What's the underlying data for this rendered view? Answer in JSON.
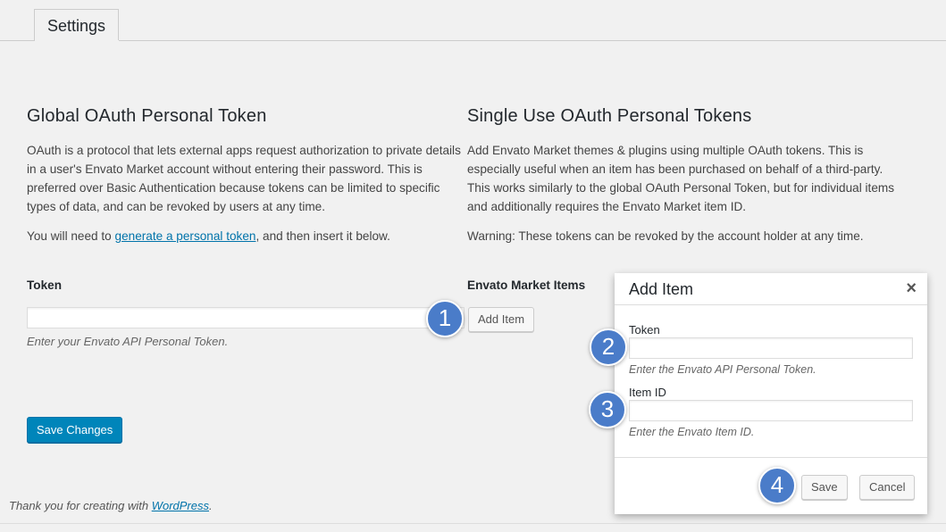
{
  "tabs": [
    {
      "label": "Settings"
    }
  ],
  "global": {
    "title": "Global OAuth Personal Token",
    "description": "OAuth is a protocol that lets external apps request authorization to private details in a user's Envato Market account without entering their password. This is preferred over Basic Authentication because tokens can be limited to specific types of data, and can be revoked by users at any time.",
    "instruction_prefix": "You will need to ",
    "instruction_link": "generate a personal token",
    "instruction_suffix": ", and then insert it below.",
    "token_label": "Token",
    "token_value": "",
    "token_help": "Enter your Envato API Personal Token."
  },
  "single": {
    "title": "Single Use OAuth Personal Tokens",
    "description": "Add Envato Market themes & plugins using multiple OAuth tokens. This is especially useful when an item has been purchased on behalf of a third-party. This works similarly to the global OAuth Personal Token, but for individual items and additionally requires the Envato Market item ID.",
    "warning": "Warning: These tokens can be revoked by the account holder at any time.",
    "items_label": "Envato Market Items",
    "add_item_button": "Add Item"
  },
  "save_changes_button": "Save Changes",
  "footer": {
    "text_prefix": "Thank you for creating with ",
    "link": "WordPress",
    "text_suffix": "."
  },
  "modal": {
    "title": "Add Item",
    "close_symbol": "×",
    "token_label": "Token",
    "token_value": "",
    "token_help": "Enter the Envato API Personal Token.",
    "item_id_label": "Item ID",
    "item_id_value": "",
    "item_id_help": "Enter the Envato Item ID.",
    "save_button": "Save",
    "cancel_button": "Cancel"
  },
  "callouts": [
    "1",
    "2",
    "3",
    "4"
  ],
  "colors": {
    "primary_button": "#0085ba",
    "link": "#0073aa",
    "callout_badge": "#4a7cc9",
    "background": "#f1f1f1"
  }
}
